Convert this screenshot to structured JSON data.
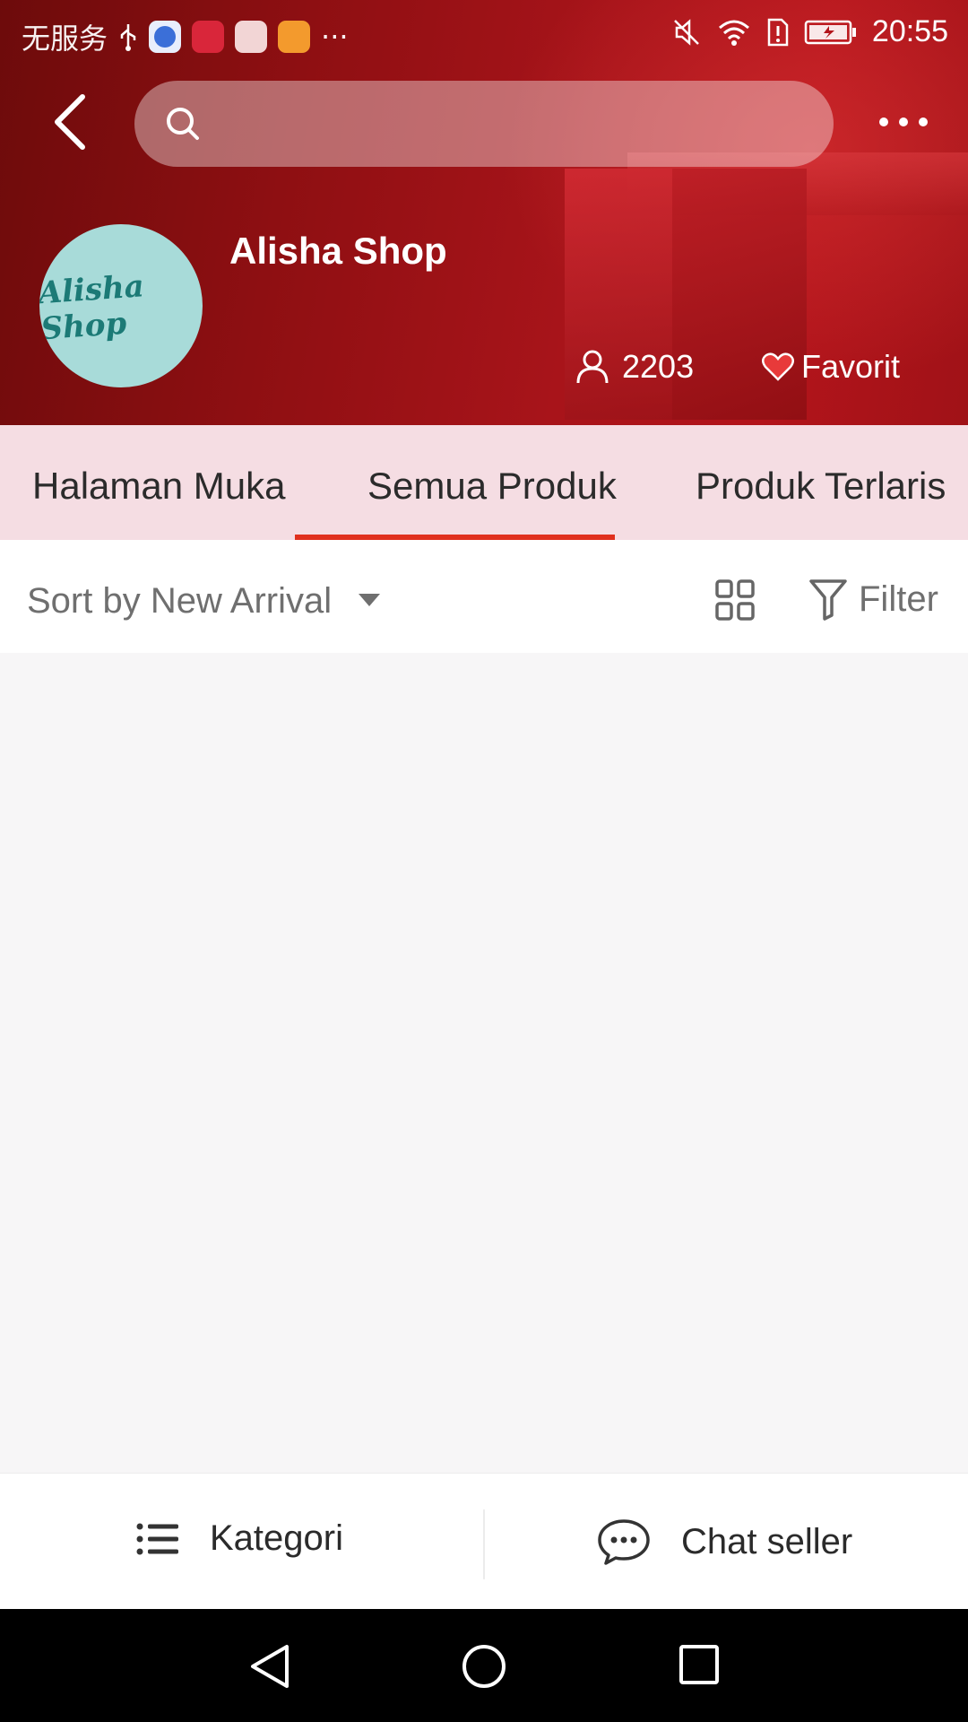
{
  "status_bar": {
    "carrier": "无服务",
    "time": "20:55",
    "overflow": "···"
  },
  "header": {
    "search": {
      "placeholder": ""
    },
    "shop": {
      "name": "Alisha Shop",
      "logo_text": "Alisha Shop",
      "followers": "2203",
      "favorite_label": "Favorit"
    }
  },
  "tabs": [
    {
      "label": "Halaman Muka",
      "active": false
    },
    {
      "label": "Semua Produk",
      "active": true
    },
    {
      "label": "Produk Terlaris",
      "active": false
    }
  ],
  "toolbar": {
    "sort_label": "Sort by New Arrival",
    "filter_label": "Filter"
  },
  "bottom_bar": {
    "category_label": "Kategori",
    "chat_label": "Chat seller"
  },
  "colors": {
    "header_red": "#a8141a",
    "tab_bg": "#f5dde3",
    "active_underline": "#e0301e"
  },
  "icons": [
    "back-arrow-icon",
    "search-icon",
    "more-icon",
    "person-icon",
    "heart-icon",
    "caret-down-icon",
    "grid-view-icon",
    "filter-icon",
    "list-icon",
    "chat-bubble-icon",
    "nav-back-icon",
    "nav-home-icon",
    "nav-recents-icon"
  ]
}
